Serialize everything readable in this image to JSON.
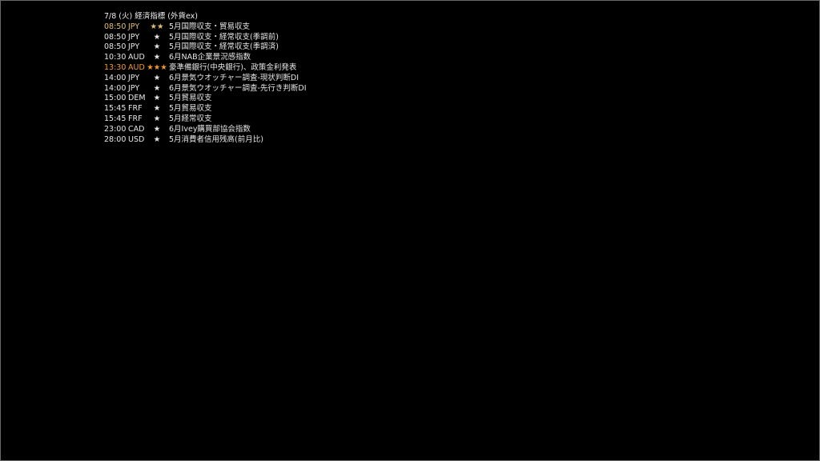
{
  "header": {
    "title": "7/8 (火) 経済指標 (外貨ex)"
  },
  "colors": {
    "normal": "#e6e6e6",
    "highlight2": "#e0c070",
    "highlight3": "#f09a2a",
    "border": "#6a6a6a",
    "background": "#000000"
  },
  "rows": [
    {
      "time": "08:50",
      "currency": "JPY",
      "stars": "★★",
      "event": "5月国際収支・貿易収支",
      "level": 2
    },
    {
      "time": "08:50",
      "currency": "JPY",
      "stars": "★",
      "event": "5月国際収支・経常収支(季調前)",
      "level": 1
    },
    {
      "time": "08:50",
      "currency": "JPY",
      "stars": "★",
      "event": "5月国際収支・経常収支(季調済)",
      "level": 1
    },
    {
      "time": "10:30",
      "currency": "AUD",
      "stars": "★",
      "event": "6月NAB企業景況感指数",
      "level": 1
    },
    {
      "time": "13:30",
      "currency": "AUD",
      "stars": "★★★",
      "event": "豪準備銀行(中央銀行)、政策金利発表",
      "level": 3
    },
    {
      "time": "14:00",
      "currency": "JPY",
      "stars": "★",
      "event": "6月景気ウオッチャー調査-現状判断DI",
      "level": 1
    },
    {
      "time": "14:00",
      "currency": "JPY",
      "stars": "★",
      "event": "6月景気ウオッチャー調査-先行き判断DI",
      "level": 1
    },
    {
      "time": "15:00",
      "currency": "DEM",
      "stars": "★",
      "event": "5月貿易収支",
      "level": 1
    },
    {
      "time": "15:45",
      "currency": "FRF",
      "stars": "★",
      "event": "5月貿易収支",
      "level": 1
    },
    {
      "time": "15:45",
      "currency": "FRF",
      "stars": "★",
      "event": "5月経常収支",
      "level": 1
    },
    {
      "time": "23:00",
      "currency": "CAD",
      "stars": "★",
      "event": "6月Ivey購買部協会指数",
      "level": 1
    },
    {
      "time": "28:00",
      "currency": "USD",
      "stars": "★",
      "event": "5月消費者信用残高(前月比)",
      "level": 1
    }
  ]
}
